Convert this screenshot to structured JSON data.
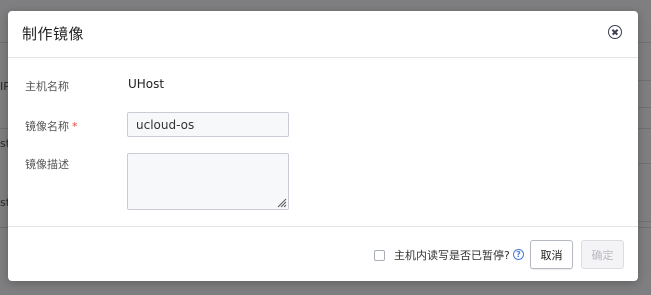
{
  "dialog": {
    "title": "制作镜像",
    "close_icon": "close-circle-icon"
  },
  "form": {
    "host_name": {
      "label": "主机名称",
      "value": "UHost"
    },
    "image_name": {
      "label": "镜像名称",
      "required_mark": "*",
      "value": "ucloud-os"
    },
    "image_description": {
      "label": "镜像描述",
      "value": ""
    }
  },
  "footer": {
    "paused_checkbox": {
      "label": "主机内读写是否已暂停?",
      "checked": false
    },
    "help_icon": "question-circle-icon",
    "help_glyph": "?",
    "cancel_label": "取消",
    "confirm_label": "确定"
  },
  "background": {
    "edge_fragments": [
      "IP",
      "st",
      "st"
    ]
  },
  "colors": {
    "overlay": "#7f7f81",
    "required": "#e2433a",
    "help_accent": "#4a7bd8",
    "disabled_text": "#b9bac0"
  }
}
